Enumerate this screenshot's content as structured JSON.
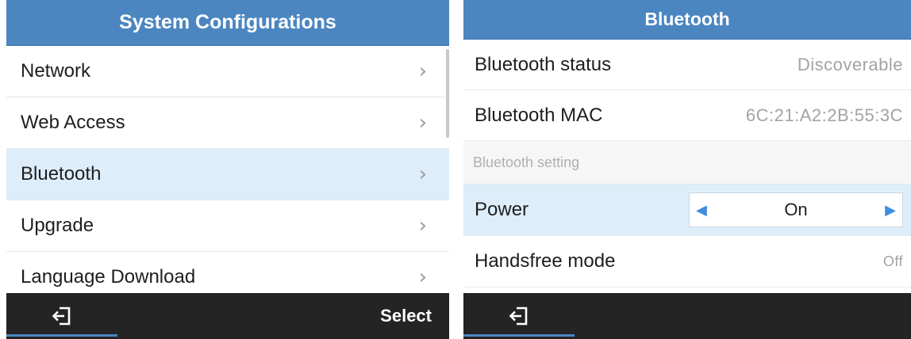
{
  "left_screen": {
    "title": "System Configurations",
    "menu_items": [
      {
        "label": "Network",
        "selected": false
      },
      {
        "label": "Web Access",
        "selected": false
      },
      {
        "label": "Bluetooth",
        "selected": true
      },
      {
        "label": "Upgrade",
        "selected": false
      },
      {
        "label": "Language Download",
        "selected": false
      }
    ],
    "chevron": "›",
    "softkeys": {
      "left_icon": "exit-icon",
      "right_label": "Select"
    }
  },
  "right_screen": {
    "title": "Bluetooth",
    "status_label": "Bluetooth status",
    "status_value": "Discoverable",
    "mac_label": "Bluetooth MAC",
    "mac_value": "6C:21:A2:2B:55:3C",
    "section_header": "Bluetooth setting",
    "power_label": "Power",
    "power_value": "On",
    "handsfree_label": "Handsfree mode",
    "handsfree_value": "Off",
    "softkeys": {
      "left_icon": "exit-icon"
    }
  },
  "colors": {
    "title_bar": "#4b86c1",
    "selected_row": "#ddeefa",
    "softkey_bar": "#242424",
    "arrow_accent": "#3f8de0"
  }
}
